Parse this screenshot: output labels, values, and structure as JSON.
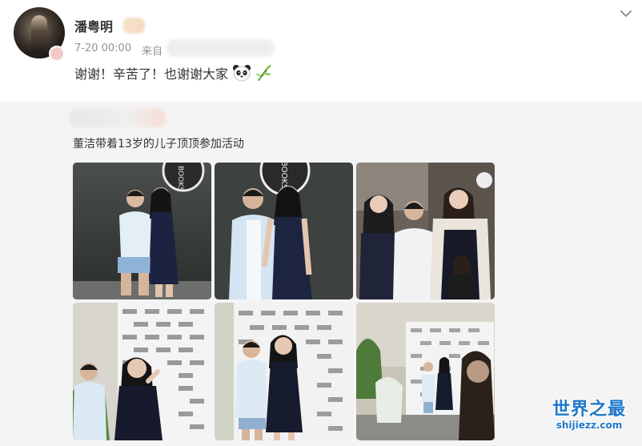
{
  "post": {
    "username": "潘粤明",
    "time": "7-20 00:00",
    "from_label": "来自",
    "text": "谢谢！辛苦了！也谢谢大家"
  },
  "repost": {
    "text": "董洁带着13岁的儿子顶顶参加活动",
    "photo_count": 6
  },
  "backdrop_logo": {
    "text": "BOOKS"
  },
  "watermark": {
    "title": "世界之最",
    "url": "shijiezz.com"
  },
  "colors": {
    "text": "#333333",
    "meta": "#939393",
    "repost_bg": "#f4f4f4",
    "watermark": "#1d78c9"
  },
  "icons": {
    "emoji_1": "panda",
    "emoji_2": "bamboo",
    "menu": "chevron-down"
  }
}
